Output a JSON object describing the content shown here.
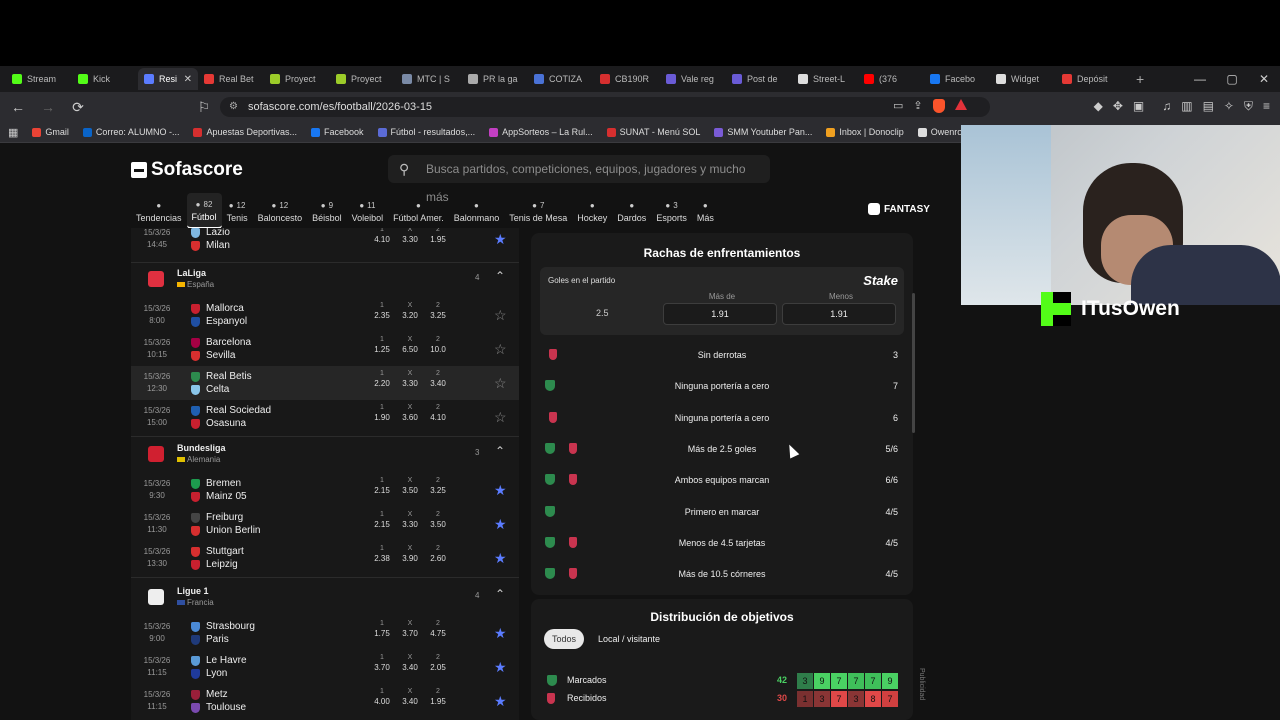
{
  "browser": {
    "tabs": [
      {
        "label": "Stream",
        "color": "#53fc18"
      },
      {
        "label": "Kick",
        "color": "#53fc18"
      },
      {
        "label": "Resi",
        "color": "#5b7cff",
        "active": true
      },
      {
        "label": "Real Bet",
        "color": "#e53935"
      },
      {
        "label": "Proyect",
        "color": "#9ccc29"
      },
      {
        "label": "Proyect",
        "color": "#9ccc29"
      },
      {
        "label": "MTC | S",
        "color": "#7a8aa6"
      },
      {
        "label": "PR la ga",
        "color": "#aaaaaa"
      },
      {
        "label": "COTIZA",
        "color": "#4a72d6"
      },
      {
        "label": "CB190R",
        "color": "#d62f2f"
      },
      {
        "label": "Vale reg",
        "color": "#6a5bd6"
      },
      {
        "label": "Post de",
        "color": "#6a5bd6"
      },
      {
        "label": "Street-L",
        "color": "#dddddd"
      },
      {
        "label": "(376",
        "color": "#ff0000"
      },
      {
        "label": "Facebo",
        "color": "#1877f2"
      },
      {
        "label": "Widget",
        "color": "#dddddd"
      },
      {
        "label": "Depósit",
        "color": "#e53935"
      }
    ],
    "url": "sofascore.com/es/football/2026-03-15",
    "bookmarks": [
      {
        "label": "Gmail",
        "color": "#ea4335"
      },
      {
        "label": "Correo: ALUMNO -...",
        "color": "#0a64c8"
      },
      {
        "label": "Apuestas Deportivas...",
        "color": "#d62f2f"
      },
      {
        "label": "Facebook",
        "color": "#1877f2"
      },
      {
        "label": "Fútbol - resultados,...",
        "color": "#5b6bd6"
      },
      {
        "label": "AppSorteos – La Rul...",
        "color": "#c23fc2"
      },
      {
        "label": "SUNAT - Menú SOL",
        "color": "#d62f2f"
      },
      {
        "label": "SMM Youtuber Pan...",
        "color": "#7a5bd6"
      },
      {
        "label": "Inbox | Donoclip",
        "color": "#f0a020"
      },
      {
        "label": "Owenrozz (@o",
        "color": "#dddddd"
      }
    ]
  },
  "site": {
    "logo": "Sofascore",
    "search_placeholder": "Busca partidos, competiciones, equipos, jugadores y mucho más",
    "sports": [
      {
        "name": "Tendencias",
        "count": ""
      },
      {
        "name": "Fútbol",
        "count": "82",
        "active": true
      },
      {
        "name": "Tenis",
        "count": "12"
      },
      {
        "name": "Baloncesto",
        "count": "12"
      },
      {
        "name": "Béisbol",
        "count": "9"
      },
      {
        "name": "Voleibol",
        "count": "11"
      },
      {
        "name": "Fútbol Amer.",
        "count": ""
      },
      {
        "name": "Balonmano",
        "count": ""
      },
      {
        "name": "Tenis de Mesa",
        "count": "7"
      },
      {
        "name": "Hockey",
        "count": ""
      },
      {
        "name": "Dardos",
        "count": ""
      },
      {
        "name": "Esports",
        "count": "3"
      },
      {
        "name": "Más",
        "count": ""
      }
    ],
    "fantasy": "FANTASY"
  },
  "matches": {
    "odds_header": [
      "1",
      "X",
      "2"
    ],
    "top_match": {
      "date": "15/3/26",
      "time": "14:45",
      "home": "Lazio",
      "away": "Milan",
      "odds": [
        "4.10",
        "3.30",
        "1.95"
      ],
      "home_color": "#7fb7e0",
      "away_color": "#d62f2f"
    },
    "leagues": [
      {
        "name": "LaLiga",
        "country": "España",
        "count": "4",
        "matches": [
          {
            "date": "15/3/26",
            "time": "8:00",
            "home": "Mallorca",
            "away": "Espanyol",
            "odds": [
              "2.35",
              "3.20",
              "3.25"
            ],
            "home_color": "#c8202f",
            "away_color": "#1f4fa3"
          },
          {
            "date": "15/3/26",
            "time": "10:15",
            "home": "Barcelona",
            "away": "Sevilla",
            "odds": [
              "1.25",
              "6.50",
              "10.0"
            ],
            "home_color": "#a50044",
            "away_color": "#d62f2f"
          },
          {
            "date": "15/3/26",
            "time": "12:30",
            "home": "Real Betis",
            "away": "Celta",
            "odds": [
              "2.20",
              "3.30",
              "3.40"
            ],
            "home_color": "#2d8b4e",
            "away_color": "#8ac6ea"
          },
          {
            "date": "15/3/26",
            "time": "15:00",
            "home": "Real Sociedad",
            "away": "Osasuna",
            "odds": [
              "1.90",
              "3.60",
              "4.10"
            ],
            "home_color": "#1f5fb0",
            "away_color": "#c8202f"
          }
        ]
      },
      {
        "name": "Bundesliga",
        "country": "Alemania",
        "count": "3",
        "matches": [
          {
            "date": "15/3/26",
            "time": "9:30",
            "home": "Bremen",
            "away": "Mainz 05",
            "odds": [
              "2.15",
              "3.50",
              "3.25"
            ],
            "home_color": "#1d9a4e",
            "away_color": "#c8202f"
          },
          {
            "date": "15/3/26",
            "time": "11:30",
            "home": "Freiburg",
            "away": "Union Berlin",
            "odds": [
              "2.15",
              "3.30",
              "3.50"
            ],
            "home_color": "#444444",
            "away_color": "#d62f2f"
          },
          {
            "date": "15/3/26",
            "time": "13:30",
            "home": "Stuttgart",
            "away": "Leipzig",
            "odds": [
              "2.38",
              "3.90",
              "2.60"
            ],
            "home_color": "#d62f2f",
            "away_color": "#c8202f"
          }
        ]
      },
      {
        "name": "Ligue 1",
        "country": "Francia",
        "count": "4",
        "matches": [
          {
            "date": "15/3/26",
            "time": "9:00",
            "home": "Strasbourg",
            "away": "Paris",
            "odds": [
              "1.75",
              "3.70",
              "4.75"
            ],
            "home_color": "#4a8ad6",
            "away_color": "#1f3a7a"
          },
          {
            "date": "15/3/26",
            "time": "11:15",
            "home": "Le Havre",
            "away": "Lyon",
            "odds": [
              "3.70",
              "3.40",
              "2.05"
            ],
            "home_color": "#5a9ad6",
            "away_color": "#1f3a9a"
          },
          {
            "date": "15/3/26",
            "time": "11:15",
            "home": "Metz",
            "away": "Toulouse",
            "odds": [
              "4.00",
              "3.40",
              "1.95"
            ],
            "home_color": "#9a1f3a",
            "away_color": "#7a4ab0"
          }
        ]
      }
    ]
  },
  "streaks": {
    "title": "Rachas de enfrentamientos",
    "bet": {
      "label": "Goles en el partido",
      "brand": "Stake",
      "line": "2.5",
      "over_label": "Más de",
      "over": "1.91",
      "under_label": "Menos",
      "under": "1.91"
    },
    "rows": [
      {
        "teams": [
          "celta"
        ],
        "text": "Sin derrotas",
        "value": "3"
      },
      {
        "teams": [
          "betis"
        ],
        "text": "Ninguna portería a cero",
        "value": "7"
      },
      {
        "teams": [
          "celta"
        ],
        "text": "Ninguna portería a cero",
        "value": "6"
      },
      {
        "teams": [
          "betis",
          "celta"
        ],
        "text": "Más de 2.5 goles",
        "value": "5/6"
      },
      {
        "teams": [
          "betis",
          "celta"
        ],
        "text": "Ambos equipos marcan",
        "value": "6/6"
      },
      {
        "teams": [
          "betis"
        ],
        "text": "Primero en marcar",
        "value": "4/5"
      },
      {
        "teams": [
          "betis",
          "celta"
        ],
        "text": "Menos de 4.5 tarjetas",
        "value": "4/5"
      },
      {
        "teams": [
          "betis",
          "celta"
        ],
        "text": "Más de 10.5 córneres",
        "value": "4/5"
      }
    ]
  },
  "distribution": {
    "title": "Distribución de objetivos",
    "tabs": [
      "Todos",
      "Local / visitante"
    ],
    "rows": [
      {
        "label": "Marcados",
        "total": "42",
        "cells": [
          "3",
          "9",
          "7",
          "7",
          "7",
          "9"
        ],
        "colors": [
          "#2f7d4a",
          "#4ad163",
          "#4ad163",
          "#3fbf5a",
          "#3fbf5a",
          "#4ad163"
        ]
      },
      {
        "label": "Recibidos",
        "total": "30",
        "cells": [
          "1",
          "3",
          "7",
          "3",
          "8",
          "7"
        ],
        "colors": [
          "#7a3030",
          "#8a3535",
          "#e04848",
          "#8a3535",
          "#e04848",
          "#d04040"
        ]
      }
    ]
  },
  "publicidad": "Publicidad",
  "streamer": {
    "name": "ITusOwen"
  }
}
